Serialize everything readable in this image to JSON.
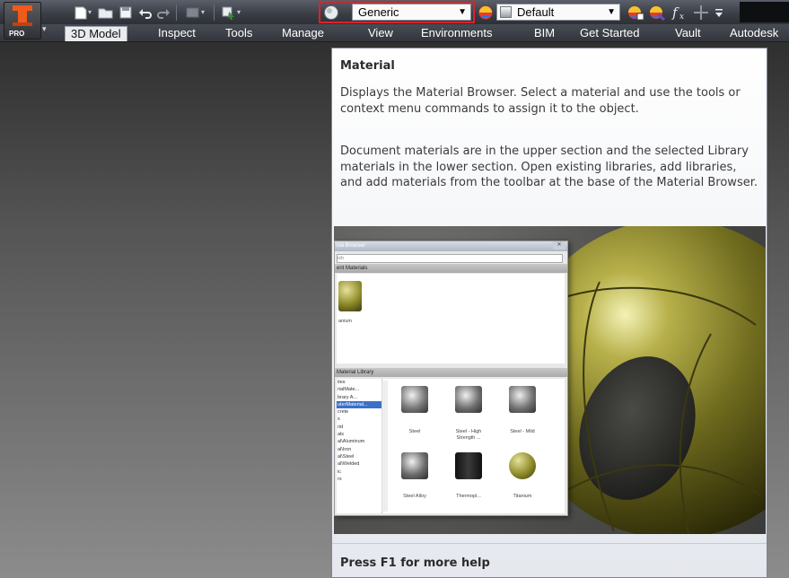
{
  "app": {
    "logo_badge": "PRO",
    "logo_icon": "inventor-logo-icon",
    "accent": "#f05a1a"
  },
  "toolbar": {
    "material_combo_value": "Generic",
    "appearance_combo_value": "Default",
    "highlight_color": "#e0202a"
  },
  "ribbon": {
    "tabs": [
      "3D Model",
      "Inspect",
      "Tools",
      "Manage",
      "View",
      "Environments",
      "BIM",
      "Get Started",
      "Vault",
      "Autodesk"
    ],
    "active_tab": "3D Model"
  },
  "tooltip": {
    "title": "Material",
    "description": "Displays the Material Browser. Select a material and use the tools or context menu commands to assign it to the object.",
    "detail": "Document materials are in the upper section and the selected Library materials in the lower section. Open existing libraries, add libraries, and add materials from the toolbar at the base of the Material Browser.",
    "footer": "Press F1 for more help"
  },
  "preview": {
    "window_title": "rial Browser",
    "search_placeholder": "rch",
    "doc_section": "ent Materials",
    "doc_item": "anium",
    "lib_section": "Material Library",
    "tree": [
      "ites",
      "rialMate...",
      "brary A...",
      "uterMaterial...",
      "crete",
      "s",
      "rid",
      "als",
      "al\\Aluminum",
      "al\\Iron",
      "al\\Steel",
      "al\\Welded",
      "ic",
      "rs"
    ],
    "tree_selected_index": 3,
    "swatches": [
      "Steel",
      "Steel - High Strength ...",
      "Steel - Mild",
      "Steel Alloy",
      "Thermopl...",
      "Titanium"
    ]
  }
}
